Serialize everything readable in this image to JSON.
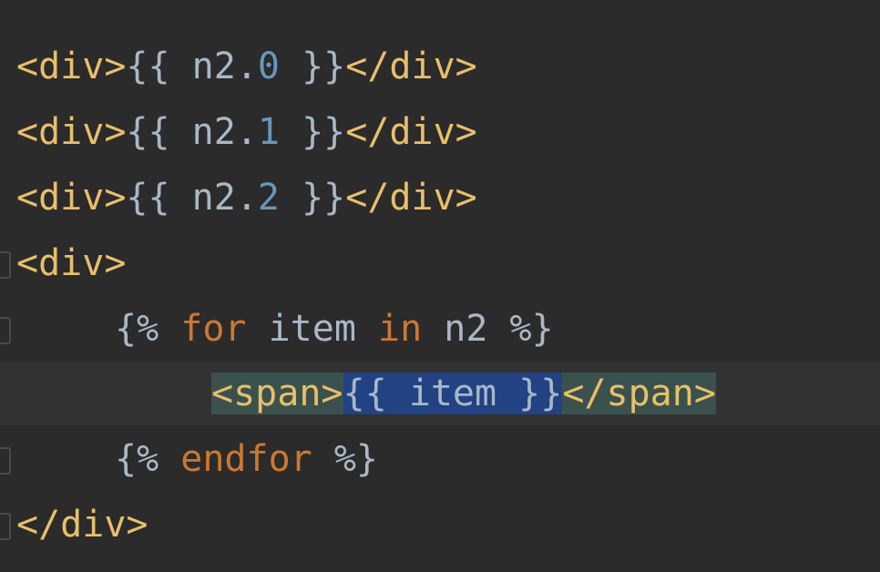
{
  "editor": {
    "lines": [
      {
        "open_tag": "<div>",
        "open_expr": "{{ ",
        "var": "n2.",
        "index": "0",
        "close_expr": " }}",
        "close_tag": "</div>"
      },
      {
        "open_tag": "<div>",
        "open_expr": "{{ ",
        "var": "n2.",
        "index": "1",
        "close_expr": " }}",
        "close_tag": "</div>"
      },
      {
        "open_tag": "<div>",
        "open_expr": "{{ ",
        "var": "n2.",
        "index": "2",
        "close_expr": " }}",
        "close_tag": "</div>"
      }
    ],
    "div_open": "<div>",
    "for_open": "{% ",
    "for_kw": "for",
    "for_var": " item ",
    "in_kw": "in",
    "for_iter": " n2 ",
    "for_close": "%}",
    "span_open": "<span>",
    "span_expr": "{{ item }}",
    "span_close": "</span>",
    "endfor_open": "{% ",
    "endfor_kw": "endfor",
    "endfor_close": " %}",
    "div_close": "</div>"
  },
  "colors": {
    "background": "#2b2b2b",
    "tag": "#e8bf6a",
    "number": "#6897bb",
    "keyword": "#cc7832",
    "selection": "#214283",
    "tag_match": "#3b514d"
  }
}
